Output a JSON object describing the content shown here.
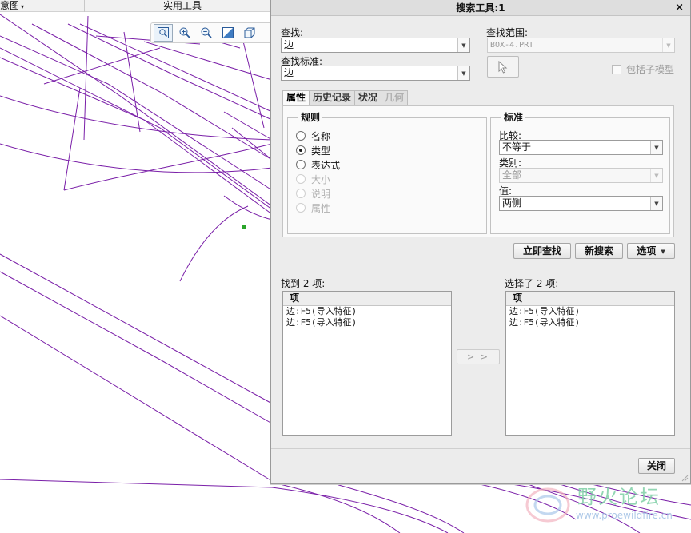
{
  "app": {
    "ribbon": {
      "left_tab": "意图",
      "left_tab_caret": "▾",
      "mid_tab": "实用工具"
    }
  },
  "view_toolbar": {
    "icons": [
      "zoom-window-icon",
      "zoom-in-icon",
      "zoom-out-icon",
      "repaint-icon",
      "display-style-icon"
    ]
  },
  "dialog": {
    "title": "搜索工具:1",
    "close": "×",
    "find_label": "查找:",
    "find_value": "边",
    "look_in_label": "查找范围:",
    "look_in_value": "BOX-4.PRT",
    "criteria_label": "查找标准:",
    "criteria_value": "边",
    "include_submodels_label": "包括子模型",
    "tabs": [
      {
        "label": "属性",
        "state": "active"
      },
      {
        "label": "历史记录",
        "state": "normal"
      },
      {
        "label": "状况",
        "state": "normal"
      },
      {
        "label": "几何",
        "state": "disabled"
      }
    ],
    "rules": {
      "title": "规则",
      "options": [
        {
          "label": "名称",
          "checked": false,
          "disabled": false
        },
        {
          "label": "类型",
          "checked": true,
          "disabled": false
        },
        {
          "label": "表达式",
          "checked": false,
          "disabled": false
        },
        {
          "label": "大小",
          "checked": false,
          "disabled": true
        },
        {
          "label": "说明",
          "checked": false,
          "disabled": true
        },
        {
          "label": "属性",
          "checked": false,
          "disabled": true
        }
      ]
    },
    "criteria": {
      "title": "标准",
      "compare_label": "比较:",
      "compare_value": "不等于",
      "category_label": "类别:",
      "category_value": "全部",
      "value_label": "值:",
      "value_value": "两侧"
    },
    "buttons": {
      "find_now": "立即查找",
      "new_search": "新搜索",
      "options": "选项",
      "options_caret": "▼",
      "transfer": "> >",
      "close": "关闭"
    },
    "found": {
      "label": "找到 2 项:",
      "header": "项",
      "items": [
        "边:F5(导入特征)",
        "边:F5(导入特征)"
      ]
    },
    "selected": {
      "label": "选择了 2 项:",
      "header": "项",
      "items": [
        "边:F5(导入特征)",
        "边:F5(导入特征)"
      ]
    }
  },
  "watermark": {
    "title": "野火论坛",
    "url": "www.proewildfire.cn"
  }
}
